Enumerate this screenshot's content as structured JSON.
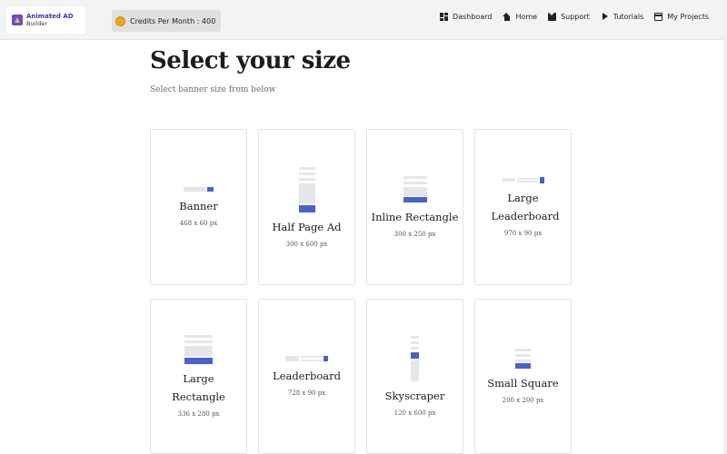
{
  "header": {
    "logo_title": "Animated AD",
    "logo_subtitle": "Builder",
    "credits": "Credits Per Month : 400",
    "nav": [
      {
        "label": "Dashboard",
        "icon": "dashboard-icon"
      },
      {
        "label": "Home",
        "icon": "home-icon"
      },
      {
        "label": "Support",
        "icon": "mail-icon"
      },
      {
        "label": "Tutorials",
        "icon": "play-icon"
      },
      {
        "label": "My Projects",
        "icon": "projects-icon"
      }
    ]
  },
  "main": {
    "title": "Select your size",
    "subtitle": "Select banner size from below",
    "cards": [
      {
        "name": "Banner",
        "size": "468 x 60 px"
      },
      {
        "name": "Half Page Ad",
        "size": "300 x 600 px"
      },
      {
        "name": "Inline Rectangle",
        "size": "300 x 250 px"
      },
      {
        "name": "Large Leaderboard",
        "size": "970 x 90 px"
      },
      {
        "name": "Large Rectangle",
        "size": "336 x 280 px"
      },
      {
        "name": "Leaderboard",
        "size": "728 x 90 px"
      },
      {
        "name": "Skyscraper",
        "size": "120 x 600 px"
      },
      {
        "name": "Small Square",
        "size": "200 x 200 px"
      }
    ]
  },
  "colors": {
    "accent": "#4a61cc",
    "placeholder": "#e6e6ea",
    "logo_brand": "#6b4bd6",
    "coin": "#f0a818"
  }
}
